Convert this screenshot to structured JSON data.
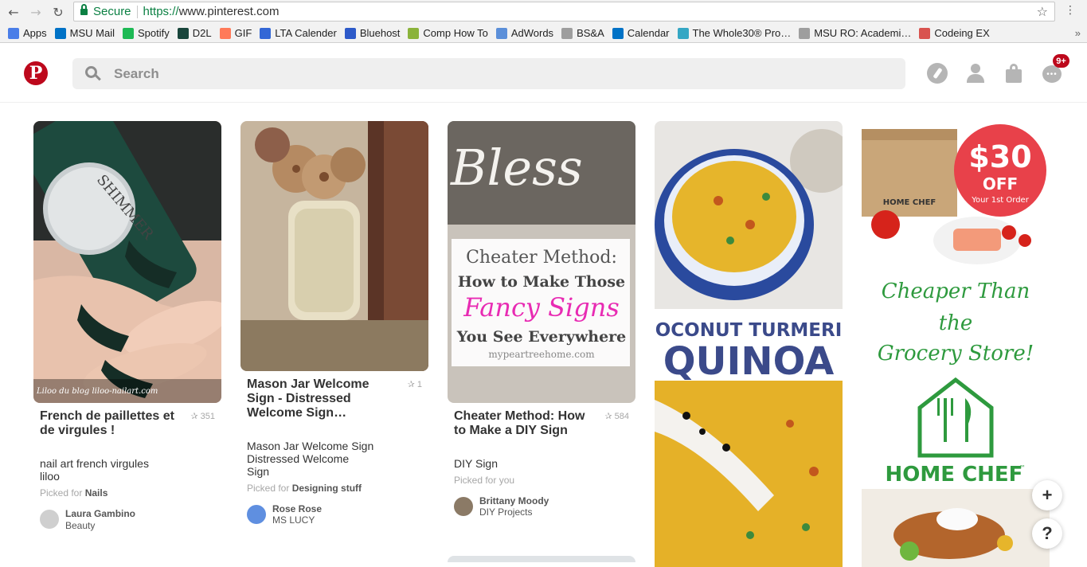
{
  "browser": {
    "secure_label": "Secure",
    "url_scheme": "https://",
    "url_host": "www.pinterest.com",
    "bookmarks": [
      {
        "label": "Apps",
        "color": "#4a7ee8"
      },
      {
        "label": "MSU Mail",
        "color": "#0072c6"
      },
      {
        "label": "Spotify",
        "color": "#1db954"
      },
      {
        "label": "D2L",
        "color": "#18453b"
      },
      {
        "label": "GIF",
        "color": "#ff7a59"
      },
      {
        "label": "LTA Calender",
        "color": "#3367d6"
      },
      {
        "label": "Bluehost",
        "color": "#2d5ac9"
      },
      {
        "label": "Comp How To",
        "color": "#8bb33b"
      },
      {
        "label": "AdWords",
        "color": "#5b8fd9"
      },
      {
        "label": "BS&A",
        "color": "#9e9e9e"
      },
      {
        "label": "Calendar",
        "color": "#0072c6"
      },
      {
        "label": "The Whole30® Pro…",
        "color": "#35a7c4"
      },
      {
        "label": "MSU RO: Academi…",
        "color": "#9e9e9e"
      },
      {
        "label": "Codeing EX",
        "color": "#d9534f"
      }
    ],
    "bookmarks_more": "»"
  },
  "header": {
    "logo": "P",
    "search_placeholder": "Search",
    "notification_count": "9+",
    "icons": [
      "compass-icon",
      "profile-icon",
      "shopping-bag-icon",
      "chat-icon"
    ]
  },
  "pins": [
    {
      "title": "French de paillettes et de virgules !",
      "saves": "351",
      "description": "nail art french virgules liloo",
      "picked_prefix": "Picked for",
      "picked_board": "Nails",
      "pinner": "Laura Gambino",
      "board": "Beauty",
      "image_caption": "Liloo du blog liloo-nailart.com"
    },
    {
      "title": "Mason Jar Welcome Sign - Distressed Welcome Sign…",
      "saves": "1",
      "description": "Mason Jar Welcome Sign Distressed Welcome Sign",
      "picked_prefix": "Picked for",
      "picked_board": "Designing stuff",
      "pinner": "Rose Rose",
      "board": "MS LUCY"
    },
    {
      "title": "Cheater Method: How to Make a DIY Sign",
      "saves": "584",
      "description": "DIY Sign",
      "picked_prefix": "Picked for you",
      "picked_board": "",
      "pinner": "Brittany Moody",
      "board": "DIY Projects",
      "image_text": {
        "script": "Bless",
        "line1": "Cheater Method:",
        "line2": "How to Make Those",
        "line3": "Fancy Signs",
        "line4": "You See Everywhere",
        "site": "mypeartreehome.com"
      }
    },
    {
      "image_text": {
        "line1": "COCONUT TURMERIC",
        "line2": "QUINOA"
      }
    },
    {
      "image_text": {
        "price": "$30",
        "off": "OFF",
        "sub": "Your 1st Order",
        "box_brand": "HOME CHEF",
        "slogan1": "Cheaper Than",
        "slogan2": "the",
        "slogan3": "Grocery Store!",
        "brand": "HOME CHEF",
        "tm": "™"
      }
    }
  ],
  "fabs": {
    "add": "+",
    "help": "?"
  },
  "colors": {
    "brand": "#bd081c",
    "secure": "#0b8043"
  }
}
